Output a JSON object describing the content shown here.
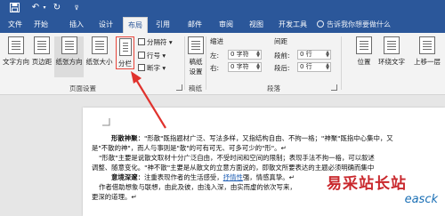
{
  "qat": {
    "save": "save-icon",
    "undo": "undo-icon",
    "redo": "redo-icon",
    "customize": "customize-qat-icon"
  },
  "tabs": [
    "文件",
    "开始",
    "插入",
    "设计",
    "布局",
    "引用",
    "邮件",
    "审阅",
    "视图",
    "开发工具"
  ],
  "tell_me": "告诉我你想要做什么",
  "page_setup": {
    "text_direction": "文字方向",
    "margins": "页边距",
    "orientation": "纸张方向",
    "size": "纸张大小",
    "columns": "分栏",
    "breaks": "分隔符",
    "line_numbers": "行号",
    "hyphenation": "断字",
    "group_label": "页面设置"
  },
  "draft": {
    "label_line1": "稿纸",
    "label_line2": "设置",
    "group_label": "稿纸"
  },
  "paragraph": {
    "indent_title": "缩进",
    "left_label": "左:",
    "left_value": "0 字符",
    "right_label": "右:",
    "right_value": "0 字符",
    "spacing_title": "间距",
    "before_label": "段前:",
    "before_value": "0 行",
    "after_label": "段后:",
    "after_value": "0 行",
    "group_label": "段落"
  },
  "arrange": {
    "position": "位置",
    "wrap": "环绕文字",
    "bring_forward": "上移一层"
  },
  "document": {
    "p1_bold": "形散神聚",
    "p1_text": "：\"形散\"既指题材广泛、写法多样，又指结构自由、不拘一格；\"神聚\"既指中心集中，又",
    "p2": "是\"不散的神\"，而人与事则是\"散\"的可有可无、可多可少的\"形\"。↵",
    "p3": "\"形散\"主要是说散文取材十分广泛自由，不受时间和空间的限制；表现手法不拘一格，可以叙述",
    "p4": "调整、随意变化。\"神不散\"主要是从散文的立意方面说的，即散文所要表达的主题必须明确而集中",
    "p5_bold": "意境深邃",
    "p5_text_a": "：注重表现作者的生活感受，",
    "p5_link": "抒情性",
    "p5_text_b": "强，情感真挚。↵",
    "p6": "作者借助想象与联想，由此及彼，由浅入深，由实而虚的依次写来，",
    "p7": "更深的道理。↵"
  },
  "watermark": {
    "title": "易采站长站",
    "subtitle": "easck"
  },
  "accent_colors": {
    "ribbon_blue": "#2b579a",
    "annotation_red": "#e8443a"
  }
}
